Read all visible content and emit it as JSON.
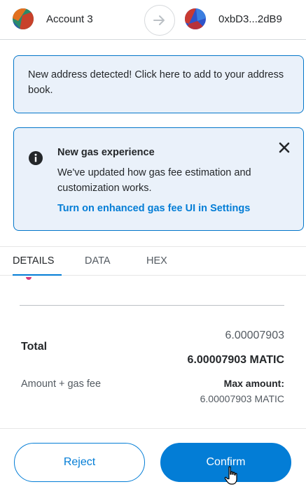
{
  "header": {
    "from_account": "Account 3",
    "to_address": "0xbD3...2dB9",
    "arrow_icon": "arrow-right-icon"
  },
  "address_banner": {
    "text": "New address detected! Click here to add to your address book."
  },
  "gas_banner": {
    "title": "New gas experience",
    "body": "We've updated how gas fee estimation and customization works.",
    "link": "Turn on enhanced gas fee UI in Settings",
    "info_icon": "info-icon",
    "close_icon": "close-icon"
  },
  "tabs": [
    {
      "label": "DETAILS",
      "active": true
    },
    {
      "label": "DATA",
      "active": false
    },
    {
      "label": "HEX",
      "active": false
    }
  ],
  "details": {
    "total_label": "Total",
    "total_amount": "6.00007903",
    "total_native": "6.00007903 MATIC",
    "amount_gas_label": "Amount + gas fee",
    "max_amount_label": "Max amount:",
    "max_amount_value": "6.00007903 MATIC"
  },
  "footer": {
    "reject_label": "Reject",
    "confirm_label": "Confirm"
  },
  "colors": {
    "accent": "#037dd6",
    "banner_bg": "#eaf1fa"
  }
}
